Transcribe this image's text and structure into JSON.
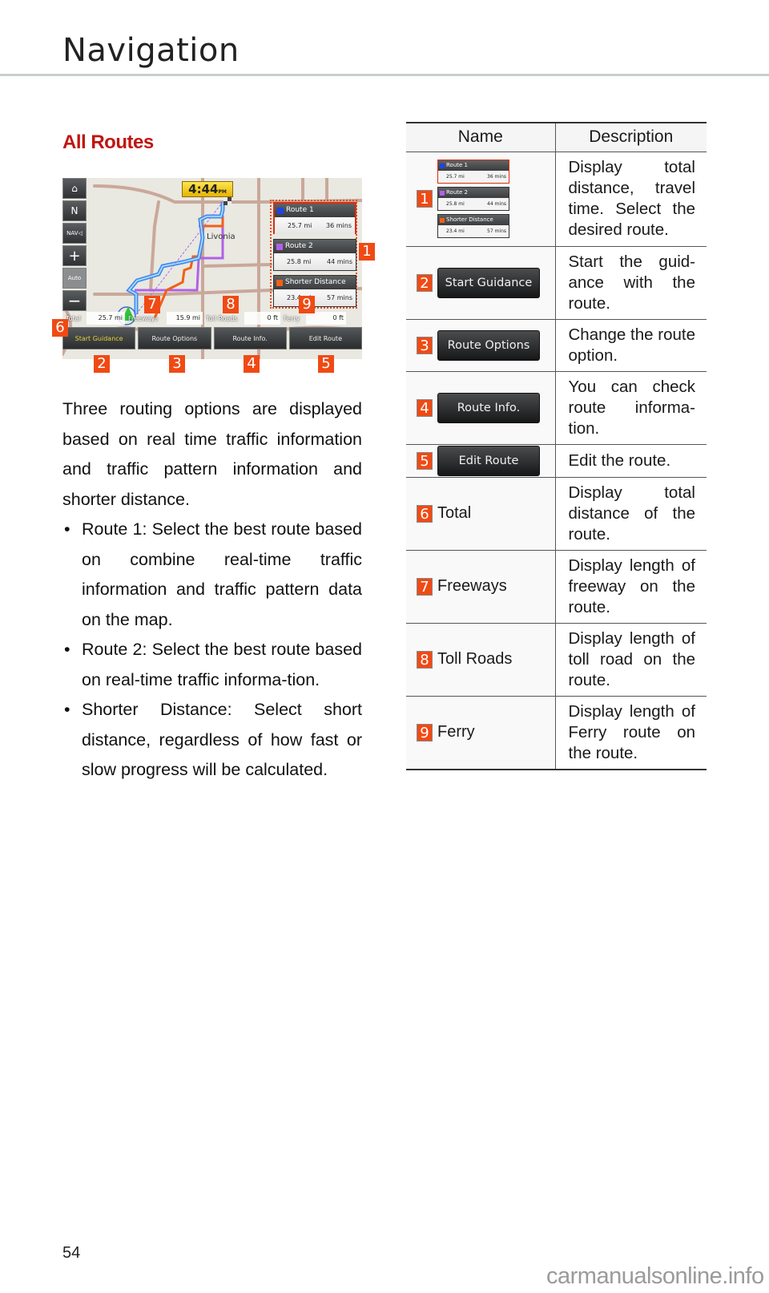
{
  "page": {
    "title": "Navigation",
    "section_heading": "All Routes",
    "page_number": "54",
    "watermark": "carmanualsonline.info"
  },
  "screenshot": {
    "clock": "4:44",
    "clock_suffix": "PM",
    "map_label": "Livonia",
    "side_buttons": [
      {
        "icon": "home-icon",
        "label": "⌂"
      },
      {
        "icon": "compass-north-icon",
        "label": "N"
      },
      {
        "icon": "nav-volume-icon",
        "label": "NAV◁"
      },
      {
        "icon": "zoom-in-icon",
        "label": "+"
      },
      {
        "icon": "auto-view-icon",
        "label": "Auto"
      },
      {
        "icon": "zoom-out-icon",
        "label": "−"
      }
    ],
    "routes": [
      {
        "name": "Route 1",
        "distance": "25.7 mi",
        "time": "36 mins",
        "color": "#1e44e6",
        "selected": true
      },
      {
        "name": "Route 2",
        "distance": "25.8 mi",
        "time": "44 mins",
        "color": "#b061e8",
        "selected": false
      },
      {
        "name": "Shorter Distance",
        "distance": "23.4 mi",
        "time": "57 mins",
        "color": "#f0601a",
        "selected": false
      }
    ],
    "info": {
      "total_label": "Total",
      "total_value": "25.7 mi",
      "freeways_label": "Freeways",
      "freeways_value": "15.9 mi",
      "toll_label": "Toll Roads",
      "toll_value": "0 ft",
      "ferry_label": "Ferry",
      "ferry_value": "0 ft"
    },
    "buttons": {
      "start_guidance": "Start Guidance",
      "route_options": "Route Options",
      "route_info": "Route Info.",
      "edit_route": "Edit Route"
    },
    "callouts": [
      "1",
      "2",
      "3",
      "4",
      "5",
      "6",
      "7",
      "8",
      "9"
    ]
  },
  "body": {
    "intro": "Three routing options are displayed based on real time traffic information and traffic pattern information and shorter distance.",
    "bullets": [
      "Route 1: Select the best route based on combine real-time traffic information and traffic pattern data on the map.",
      "Route 2: Select the best route based on real-time traffic informa-tion.",
      "Shorter Distance: Select short distance, regardless of how fast or slow progress will be calculated."
    ]
  },
  "table": {
    "headers": {
      "name": "Name",
      "description": "Description"
    },
    "rows": [
      {
        "num": "1",
        "name": "",
        "type": "route-cards",
        "description": "Display total distance, travel time. Select the desired route."
      },
      {
        "num": "2",
        "name": "Start Guidance",
        "type": "button",
        "description": "Start the guid-ance with the route."
      },
      {
        "num": "3",
        "name": "Route Options",
        "type": "button",
        "description": "Change the route option."
      },
      {
        "num": "4",
        "name": "Route Info.",
        "type": "button",
        "description": "You can check route informa-tion."
      },
      {
        "num": "5",
        "name": "Edit Route",
        "type": "button",
        "description": "Edit the route."
      },
      {
        "num": "6",
        "name": "Total",
        "type": "text",
        "description": "Display total distance of the route."
      },
      {
        "num": "7",
        "name": "Freeways",
        "type": "text",
        "description": "Display length of freeway on the route."
      },
      {
        "num": "8",
        "name": "Toll Roads",
        "type": "text",
        "description": "Display length of toll road on the route."
      },
      {
        "num": "9",
        "name": "Ferry",
        "type": "text",
        "description": "Display length of Ferry route on the route."
      }
    ]
  },
  "colors": {
    "heading_red": "#c0150f",
    "callout_orange": "#f04a14",
    "route1_blue": "#1e44e6",
    "route2_purple": "#b061e8",
    "shorter_orange": "#f0601a",
    "rule_gray": "#c6cfcc"
  }
}
